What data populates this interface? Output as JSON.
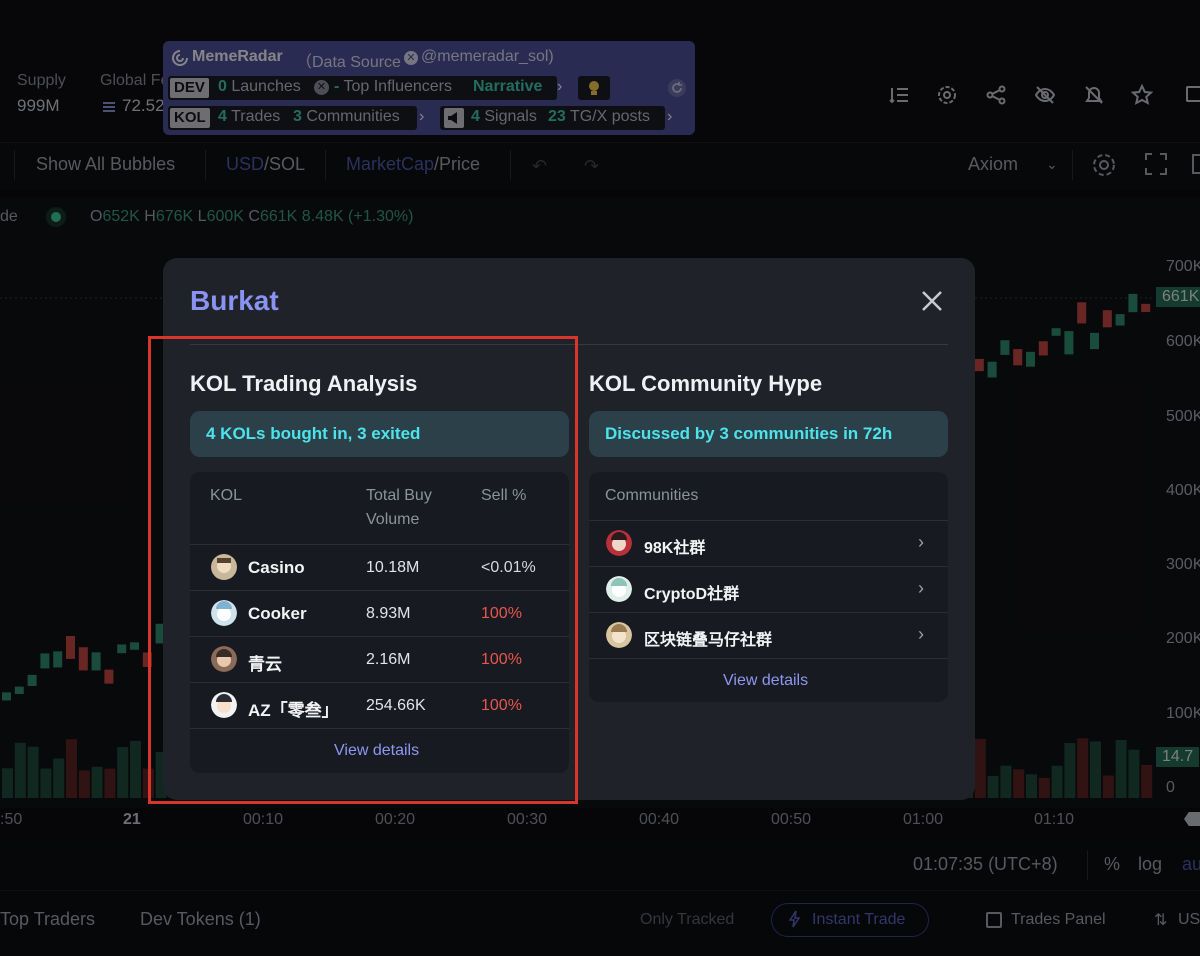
{
  "header": {
    "stats": [
      {
        "label": "Supply",
        "value": "999M"
      },
      {
        "label": "Global Fe",
        "value": "72.52"
      }
    ]
  },
  "memeradar": {
    "name": "MemeRadar",
    "source_label": "（Data Source",
    "handle": "@memeradar_sol)",
    "dev_tag": "DEV",
    "dev_launches_count": "0",
    "dev_launches_label": "Launches",
    "top_influencers_value": "-",
    "top_influencers_label": "Top Influencers",
    "narrative_label": "Narrative",
    "kol_tag": "KOL",
    "kol_trades_count": "4",
    "kol_trades_label": "Trades",
    "kol_communities_count": "3",
    "kol_communities_label": "Communities",
    "signals_count": "4",
    "signals_label": "Signals",
    "posts_count": "23",
    "posts_label": "TG/X posts"
  },
  "chart_toolbar": {
    "show_bubbles": "Show All Bubbles",
    "currency_active": "USD",
    "currency_rest": "/SOL",
    "metric_active": "MarketCap",
    "metric_rest": "/Price",
    "source": "Axiom"
  },
  "ohlc": {
    "prefix": "de",
    "o_key": "O",
    "o_val": "652K",
    "h_key": "H",
    "h_val": "676K",
    "l_key": "L",
    "l_val": "600K",
    "c_key": "C",
    "c_val": "661K",
    "change": "8.48K (+1.30%)"
  },
  "price_axis": {
    "labels": [
      "700K",
      "600K",
      "500K",
      "400K",
      "300K",
      "200K",
      "100K",
      "0"
    ],
    "current_tag": "661K",
    "volume_tag": "14.7"
  },
  "time_axis": {
    "labels": [
      ":50",
      "21",
      "00:10",
      "00:20",
      "00:30",
      "00:40",
      "00:50",
      "01:00",
      "01:10"
    ],
    "clock": "01:07:35 (UTC+8)",
    "pct": "%",
    "log": "log",
    "auto": "au"
  },
  "bottom_bar": {
    "top_traders": "Top Traders",
    "dev_tokens": "Dev Tokens (1)",
    "only_tracked": "Only Tracked",
    "instant_trade": "Instant Trade",
    "trades_panel": "Trades Panel",
    "usd": "US"
  },
  "modal": {
    "title": "Burkat",
    "kol_section": {
      "title": "KOL Trading Analysis",
      "summary": "4 KOLs bought in, 3 exited",
      "columns": [
        "KOL",
        "Total Buy Volume",
        "Sell %"
      ],
      "rows": [
        {
          "name": "Casino",
          "volume": "10.18M",
          "sell": "<0.01%"
        },
        {
          "name": "Cooker",
          "volume": "8.93M",
          "sell": "100%"
        },
        {
          "name": "青云",
          "volume": "2.16M",
          "sell": "100%"
        },
        {
          "name": "AZ「零叁」",
          "volume": "254.66K",
          "sell": "100%"
        }
      ],
      "view_details": "View details"
    },
    "community_section": {
      "title": "KOL Community Hype",
      "summary": "Discussed by 3 communities in 72h",
      "column": "Communities",
      "rows": [
        {
          "name": "98K社群"
        },
        {
          "name": "CryptoD社群"
        },
        {
          "name": "区块链叠马仔社群"
        }
      ],
      "view_details": "View details"
    }
  },
  "colors": {
    "accent": "#8a93f2",
    "summary_text": "#4ce3ea",
    "sell_red": "#e8574e",
    "candle_green": "#2f8a6a",
    "candle_red": "#c0453f",
    "highlight": "#d8362a"
  }
}
